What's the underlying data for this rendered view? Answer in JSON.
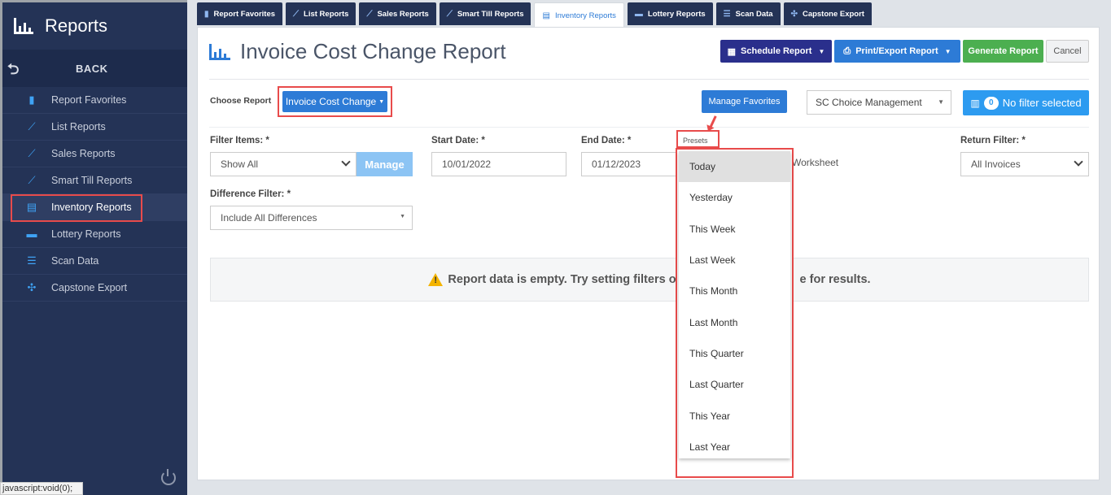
{
  "sidebar": {
    "title": "Reports",
    "back_label": "BACK",
    "items": [
      {
        "label": "Report Favorites"
      },
      {
        "label": "List Reports"
      },
      {
        "label": "Sales Reports"
      },
      {
        "label": "Smart Till Reports"
      },
      {
        "label": "Inventory Reports"
      },
      {
        "label": "Lottery Reports"
      },
      {
        "label": "Scan Data"
      },
      {
        "label": "Capstone Export"
      }
    ],
    "active_item": "Inventory Reports"
  },
  "status_bar": "javascript:void(0);",
  "tabs": [
    {
      "label": "Report Favorites"
    },
    {
      "label": "List Reports"
    },
    {
      "label": "Sales Reports"
    },
    {
      "label": "Smart Till Reports"
    },
    {
      "label": "Inventory Reports"
    },
    {
      "label": "Lottery Reports"
    },
    {
      "label": "Scan Data"
    },
    {
      "label": "Capstone Export"
    }
  ],
  "active_tab": "Inventory Reports",
  "page_title": "Invoice Cost Change Report",
  "toolbar": {
    "schedule": "Schedule Report",
    "print_export": "Print/Export Report",
    "generate": "Generate Report",
    "cancel": "Cancel"
  },
  "choose_report": {
    "label": "Choose Report",
    "value": "Invoice Cost Change"
  },
  "manage_favorites": "Manage Favorites",
  "store_select": "SC Choice Management",
  "filter_badge": {
    "count": "0",
    "text": "No filter selected"
  },
  "filters": {
    "filter_items": {
      "label": "Filter Items: *",
      "value": "Show All",
      "manage": "Manage"
    },
    "start_date": {
      "label": "Start Date: *",
      "value": "10/01/2022"
    },
    "end_date": {
      "label": "End Date: *",
      "value": "01/12/2023"
    },
    "worksheet": "Worksheet",
    "return_filter": {
      "label": "Return Filter: *",
      "value": "All Invoices"
    },
    "difference_filter": {
      "label": "Difference Filter: *",
      "value": "Include All Differences"
    }
  },
  "empty_message": {
    "left": "Report data is empty. Try setting filters o",
    "right": "e for results."
  },
  "presets": {
    "label": "Presets",
    "items": [
      "Today",
      "Yesterday",
      "This Week",
      "Last Week",
      "This Month",
      "Last Month",
      "This Quarter",
      "Last Quarter",
      "This Year",
      "Last Year"
    ],
    "highlighted": "Today"
  },
  "colors": {
    "sidebar_bg": "#243356",
    "accent_blue": "#2d7bd6",
    "schedule_btn": "#2a2f8c",
    "generate_btn": "#4caf50",
    "highlight_red": "#e84b4b"
  }
}
